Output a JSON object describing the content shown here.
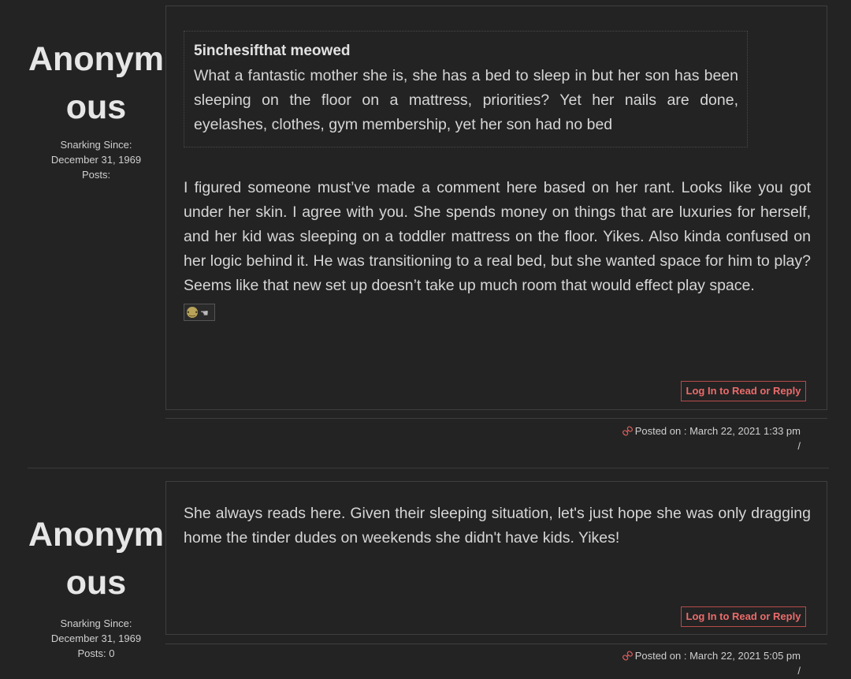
{
  "posts": [
    {
      "author": "Anonymous",
      "since_label": "Snarking Since:",
      "since_date": "December 31, 1969",
      "posts_label": "Posts:",
      "quote": {
        "author": "5inchesifthat meowed",
        "text": "What a fantastic mother she is, she has a bed to sleep in but her son has been sleeping on the floor on a mattress, priorities? Yet her nails are done, eyelashes, clothes, gym membership, yet her son had no bed"
      },
      "text": "I figured someone must’ve made a comment here based on her rant. Looks like you got under her skin. I agree with you. She spends money on things that are luxuries for herself, and her kid was sleeping on a toddler mattress on the floor. Yikes. Also kinda confused on her logic behind it. He was transitioning to a real bed, but she wanted space for him to play? Seems like that new set up doesn’t take up much room that would effect play space.",
      "emoji_icon": "thinking-pointing-emoji",
      "reply_label": "Log In to Read or Reply",
      "posted": "Posted on : March 22, 2021 1:33 pm",
      "slash": "/"
    },
    {
      "author": "Anonymous",
      "since_label": "Snarking Since:",
      "since_date": "December 31, 1969",
      "posts_label": "Posts: 0",
      "text": "She always reads here.  Given their sleeping situation, let's just hope she was only dragging home the tinder dudes on weekends she didn't have kids.  Yikes!",
      "reply_label": "Log In to Read or Reply",
      "posted": "Posted on : March 22, 2021 5:05 pm",
      "slash": "/"
    }
  ],
  "colors": {
    "background": "#232323",
    "text": "#d6d6d6",
    "accent": "#ec6b6b"
  }
}
